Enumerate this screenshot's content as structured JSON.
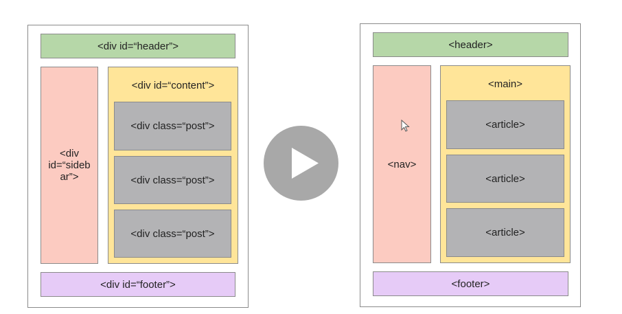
{
  "left_diagram": {
    "header": "<div id=“header”>",
    "sidebar": "<div id=“sidebar”>",
    "sidebar_lines": [
      "<div",
      "id=“sideb",
      "ar”>"
    ],
    "content": "<div id=“content”>",
    "posts": [
      "<div class=“post”>",
      "<div class=“post”>",
      "<div class=“post”>"
    ],
    "footer": "<div id=“footer”>"
  },
  "right_diagram": {
    "header": "<header>",
    "nav": "<nav>",
    "main": "<main>",
    "articles": [
      "<article>",
      "<article>",
      "<article>"
    ],
    "footer": "<footer>"
  },
  "colors": {
    "header": "#b6d7a8",
    "sidebar": "#fccbc1",
    "content": "#ffe599",
    "post": "#b3b3b5",
    "footer": "#e6cbf7",
    "play_button": "#a8a8a8"
  }
}
